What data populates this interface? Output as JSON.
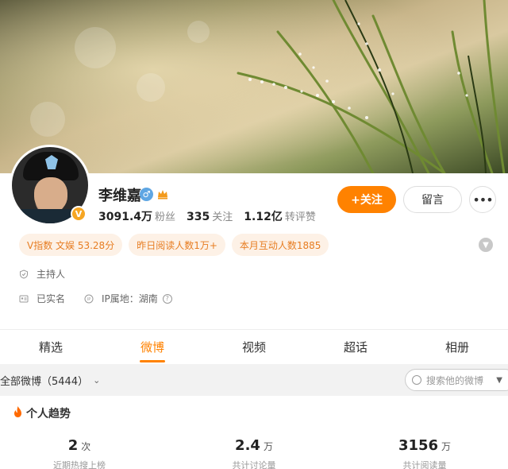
{
  "profile": {
    "name": "李维嘉",
    "verified_badge": "V",
    "gender_symbol": "♂",
    "stats": [
      {
        "value": "3091.4万",
        "label": "粉丝"
      },
      {
        "value": "335",
        "label": "关注"
      },
      {
        "value": "1.12亿",
        "label": "转评赞"
      }
    ]
  },
  "actions": {
    "follow_label": "+关注",
    "message_label": "留言",
    "more_label": "•••"
  },
  "tags": [
    "V指数 文娱 53.28分",
    "昨日阅读人数1万+",
    "本月互动人数1885"
  ],
  "info": {
    "role": "主持人",
    "real_name_status": "已实名",
    "ip_location": "IP属地：湖南"
  },
  "tabs": [
    {
      "label": "精选",
      "active": false
    },
    {
      "label": "微博",
      "active": true
    },
    {
      "label": "视频",
      "active": false
    },
    {
      "label": "超话",
      "active": false
    },
    {
      "label": "相册",
      "active": false
    }
  ],
  "filter": {
    "label": "全部微博（5444）",
    "search_placeholder": "搜索他的微博"
  },
  "trend": {
    "title": "个人趋势",
    "metrics": [
      {
        "value": "2",
        "unit": "次",
        "label": "近期热搜上榜"
      },
      {
        "value": "2.4",
        "unit": "万",
        "label": "共计讨论量"
      },
      {
        "value": "3156",
        "unit": "万",
        "label": "共计阅读量"
      }
    ]
  },
  "colors": {
    "accent": "#ff8200",
    "tag_bg": "#fdf1e6",
    "tag_text": "#e77d22"
  }
}
